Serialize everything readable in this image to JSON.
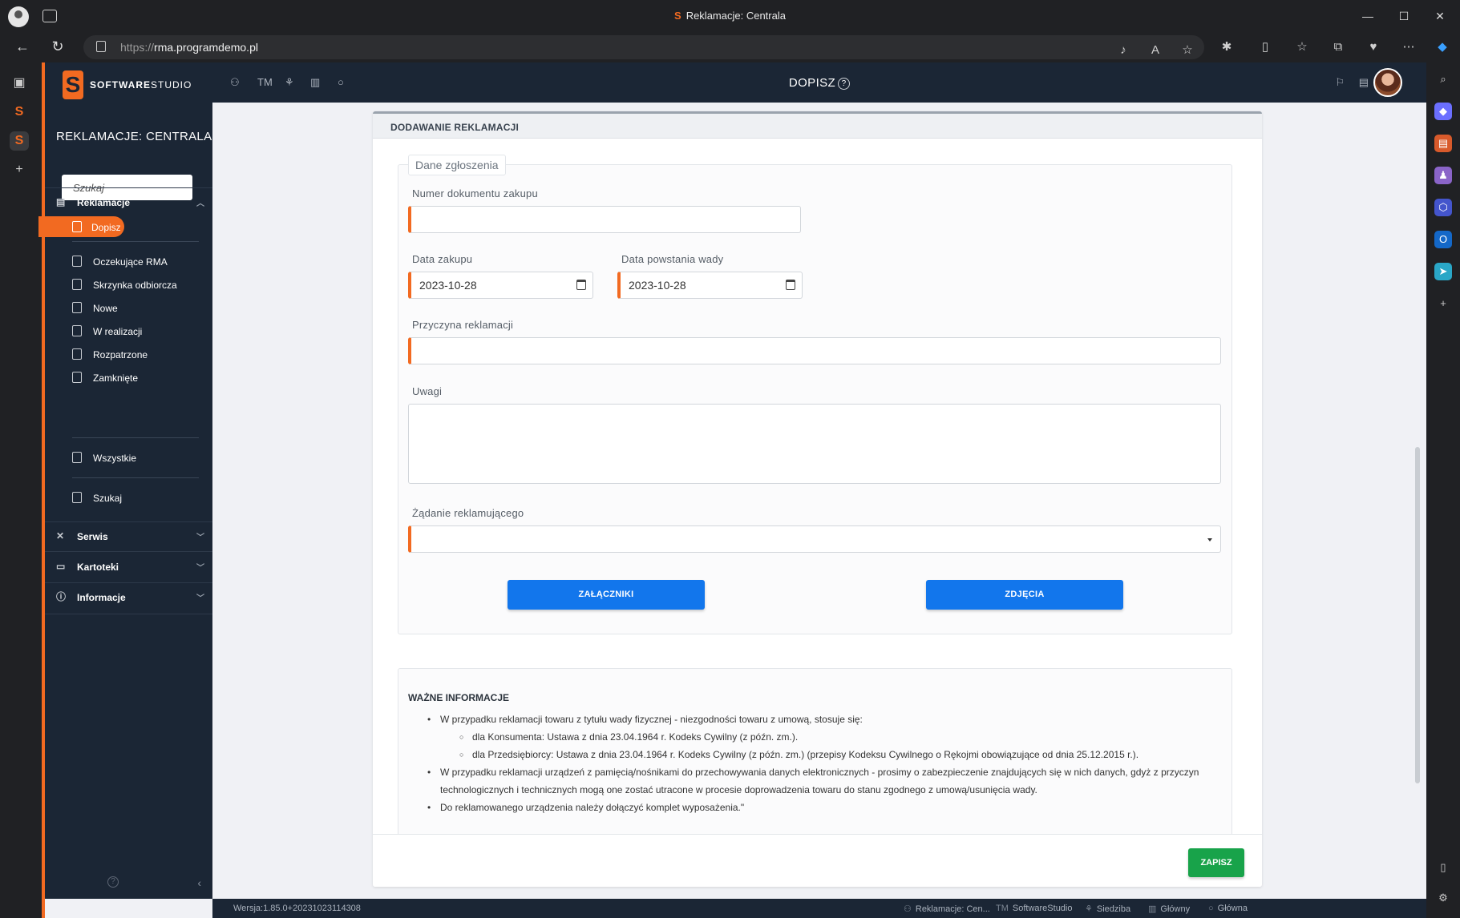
{
  "browser": {
    "tab_title": "Reklamacje: Centrala",
    "url_protocol": "https://",
    "url_host": "rma.programdemo.pl",
    "window_controls": {
      "minimize": "—",
      "maximize": "☐",
      "close": "✕"
    }
  },
  "brand": {
    "logo_strong": "SOFTWARE",
    "logo_light": "STUDIO",
    "accent": "#f26a21",
    "sidebar_bg": "#1b2635",
    "primary_blue": "#1276ec",
    "save_green": "#18a34a"
  },
  "sidebar": {
    "title": "REKLAMACJE: CENTRALA",
    "search_placeholder": "Szukaj",
    "groups": [
      {
        "label": "Reklamacje",
        "icon": "document-icon"
      },
      {
        "label": "Serwis",
        "icon": "tools-icon"
      },
      {
        "label": "Kartoteki",
        "icon": "folder-icon"
      },
      {
        "label": "Informacje",
        "icon": "info-icon"
      }
    ],
    "items": [
      {
        "label": "Dopisz",
        "active": true
      },
      {
        "label": "Oczekujące RMA"
      },
      {
        "label": "Skrzynka odbiorcza"
      },
      {
        "label": "Nowe"
      },
      {
        "label": "W realizacji"
      },
      {
        "label": "Rozpatrzone"
      },
      {
        "label": "Zamknięte"
      },
      {
        "label": "Wszystkie"
      },
      {
        "label": "Szukaj"
      }
    ]
  },
  "header": {
    "title": "DOPISZ",
    "left_icons": [
      "users-icon",
      "tm-text",
      "hierarchy-icon",
      "building-icon",
      "circle-icon"
    ],
    "tm_label": "TM"
  },
  "form": {
    "card_title": "DODAWANIE REKLAMACJI",
    "legend": "Dane zgłoszenia",
    "fields": {
      "purchase_doc_label": "Numer dokumentu zakupu",
      "purchase_doc_value": "",
      "purchase_date_label": "Data zakupu",
      "purchase_date_value": "2023-10-28",
      "defect_date_label": "Data powstania wady",
      "defect_date_value": "2023-10-28",
      "reason_label": "Przyczyna reklamacji",
      "reason_value": "",
      "notes_label": "Uwagi",
      "notes_value": "",
      "demand_label": "Żądanie reklamującego",
      "demand_value": ""
    },
    "attachments_button": "ZAŁĄCZNIKI",
    "photos_button": "ZDJĘCIA",
    "save_button": "ZAPISZ"
  },
  "info": {
    "title": "WAŻNE INFORMACJE",
    "items": [
      "W przypadku reklamacji towaru z tytułu wady fizycznej - niezgodności towaru z umową, stosuje się:",
      "dla Konsumenta: Ustawa z dnia 23.04.1964 r. Kodeks Cywilny (z późn. zm.).",
      "dla Przedsiębiorcy: Ustawa z dnia 23.04.1964 r. Kodeks Cywilny (z późn. zm.) (przepisy Kodeksu Cywilnego o Rękojmi obowiązujące od dnia 25.12.2015 r.).",
      "W przypadku reklamacji urządzeń z pamięcią/nośnikami do przechowywania danych elektronicznych - prosimy o zabezpieczenie znajdujących się w nich danych, gdyż z przyczyn technologicznych i technicznych mogą one zostać utracone w procesie doprowadzenia towaru do stanu zgodnego z umową/usunięcia wady.",
      "Do reklamowanego urządzenia należy dołączyć komplet wyposażenia.\""
    ]
  },
  "statusbar": {
    "version": "Wersja:1.85.0+20231023114308",
    "module": "Reklamacje: Cen...",
    "company": "SoftwareStudio",
    "location": "Siedziba",
    "warehouse": "Główny",
    "branch": "Główna",
    "tm_prefix": "TM"
  }
}
